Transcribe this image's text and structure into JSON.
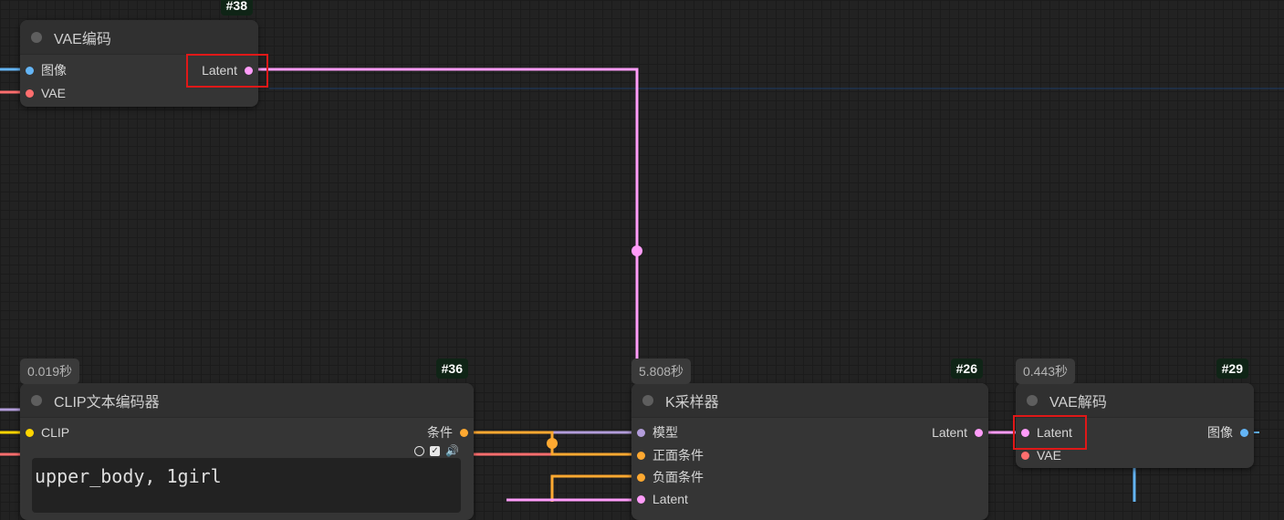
{
  "colors": {
    "latent": "#ff9cf9",
    "image": "#64b5f6",
    "vae": "#ff6e6e",
    "clip": "#ffd500",
    "conditioning": "#ffa931",
    "model": "#b39ddb"
  },
  "nodes": {
    "vae_encode": {
      "id": "#38",
      "title": "VAE编码",
      "inputs": [
        "图像",
        "VAE"
      ],
      "output": "Latent"
    },
    "clip_encode": {
      "id": "#36",
      "time": "0.019秒",
      "title": "CLIP文本编码器",
      "input": "CLIP",
      "output": "条件",
      "text": "upper_body, 1girl"
    },
    "ksampler": {
      "id": "#26",
      "time": "5.808秒",
      "title": "K采样器",
      "inputs": [
        "模型",
        "正面条件",
        "负面条件",
        "Latent"
      ],
      "output": "Latent"
    },
    "vae_decode": {
      "id": "#29",
      "time": "0.443秒",
      "title": "VAE解码",
      "inputs": [
        "Latent",
        "VAE"
      ],
      "output": "图像"
    }
  }
}
